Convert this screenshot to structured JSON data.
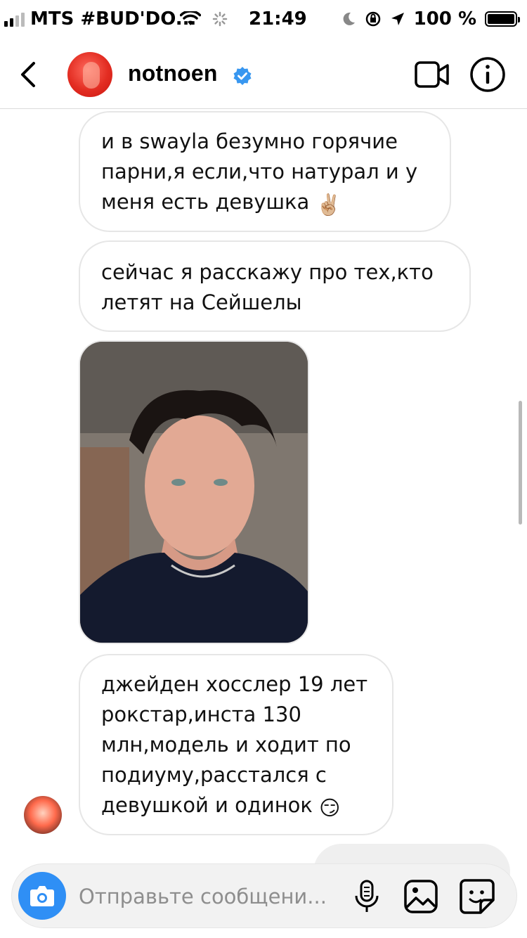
{
  "status_bar": {
    "carrier": "MTS #BUD'DO...",
    "time": "21:49",
    "battery": "100 %"
  },
  "header": {
    "username": "notnoen",
    "verified": true
  },
  "messages": [
    {
      "text": "и в swayla безумно горячие парни,я если,что натурал и у меня есть девушка",
      "emoji": "✌🏼"
    },
    {
      "text": "сейчас я расскажу про тех,кто летят на Сейшелы",
      "emoji": ""
    },
    {
      "image": "selfie-photo"
    },
    {
      "text": "джейден хосслер 19 лет рокстар,инста 130 млн,модель и ходит по подиуму,расстался с девушкой и одинок",
      "emoji": "😏"
    }
  ],
  "composer": {
    "placeholder": "Отправьте сообщени..."
  },
  "icons": [
    "back-chevron-icon",
    "verified-badge-icon",
    "video-call-icon",
    "info-icon",
    "camera-icon",
    "microphone-icon",
    "gallery-icon",
    "sticker-icon"
  ],
  "colors": {
    "accent_blue": "#2f8ff5",
    "verified_blue": "#3897f0",
    "bubble_border": "#e6e6e6",
    "placeholder_gray": "#8e8e8e"
  }
}
